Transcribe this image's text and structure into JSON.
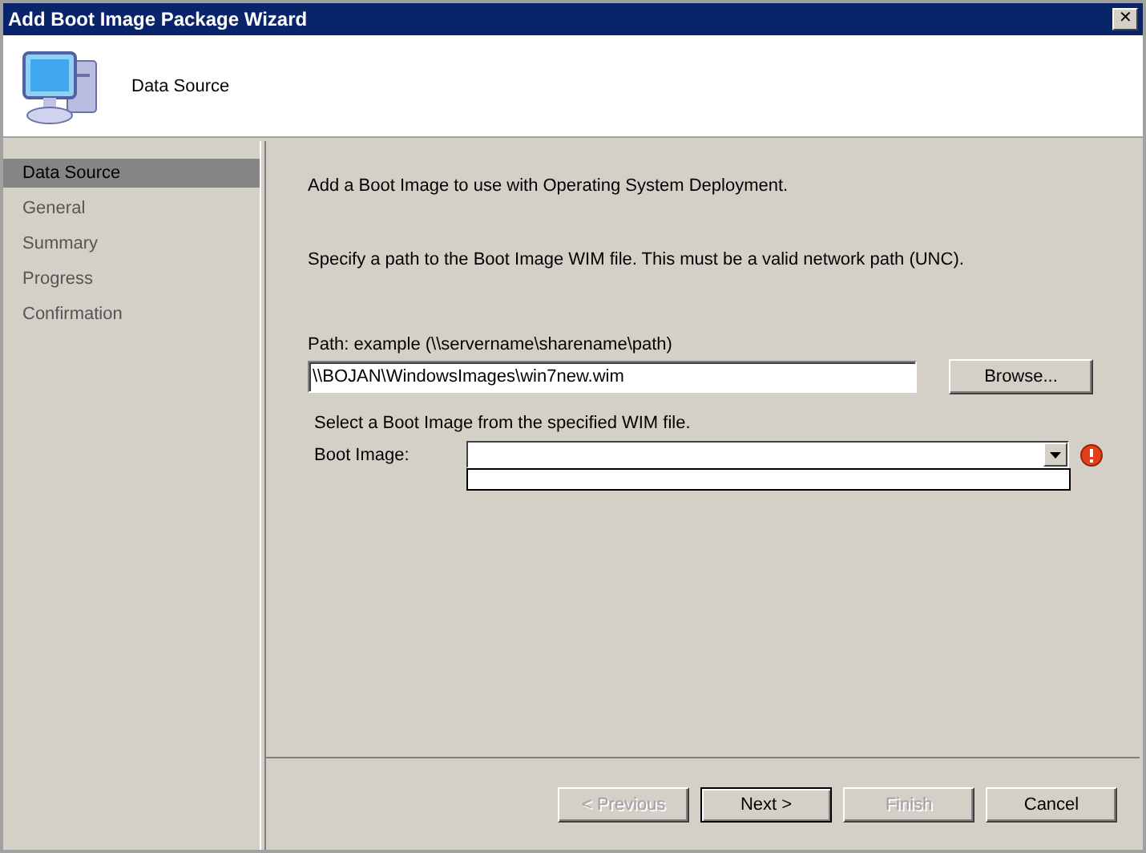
{
  "window": {
    "title": "Add Boot Image Package Wizard",
    "close": "✕"
  },
  "header": {
    "title": "Data Source"
  },
  "sidebar": {
    "items": [
      {
        "label": "Data Source",
        "selected": true
      },
      {
        "label": "General",
        "selected": false
      },
      {
        "label": "Summary",
        "selected": false
      },
      {
        "label": "Progress",
        "selected": false
      },
      {
        "label": "Confirmation",
        "selected": false
      }
    ]
  },
  "content": {
    "intro": "Add a Boot Image to use with Operating System Deployment.",
    "instruction": "Specify a path to the Boot Image WIM file. This must be a valid network path (UNC).",
    "path_label": "Path: example (\\\\servername\\sharename\\path)",
    "path_value": "\\\\BOJAN\\WindowsImages\\win7new.wim",
    "browse": "Browse...",
    "select_text": "Select a Boot Image from the specified WIM file.",
    "boot_image_label": "Boot Image:",
    "error": true
  },
  "buttons": [
    {
      "label": "< Previous",
      "disabled": true,
      "default": false
    },
    {
      "label": "Next >",
      "disabled": false,
      "default": true
    },
    {
      "label": "Finish",
      "disabled": true,
      "default": false
    },
    {
      "label": "Cancel",
      "disabled": false,
      "default": false
    }
  ]
}
